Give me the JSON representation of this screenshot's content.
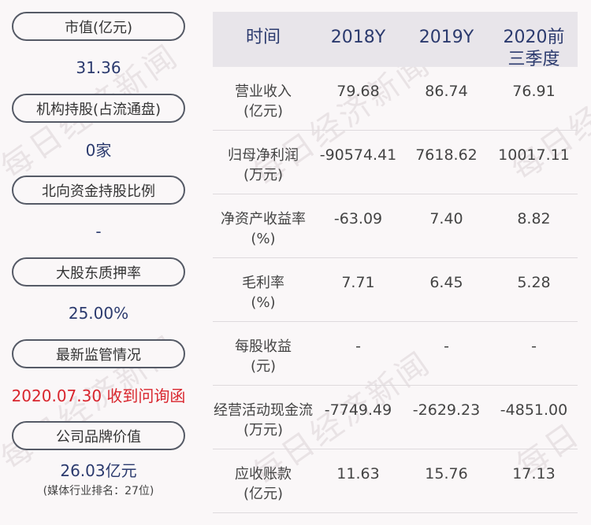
{
  "left_panel": {
    "items": [
      {
        "label": "市值(亿元)",
        "value": "31.36"
      },
      {
        "label": "机构持股(占流通盘)",
        "value": "0家"
      },
      {
        "label": "北向资金持股比例",
        "value": "-"
      },
      {
        "label": "大股东质押率",
        "value": "25.00%"
      },
      {
        "label": "最新监管情况",
        "value": "2020.07.30 收到问询函"
      },
      {
        "label": "公司品牌价值",
        "value": "26.03亿元",
        "note": "(媒体行业排名：27位)"
      }
    ]
  },
  "table": {
    "headers": [
      "时间",
      "2018Y",
      "2019Y",
      "2020前三季度"
    ],
    "rows": [
      {
        "label": "营业收入\n(亿元)",
        "values": [
          "79.68",
          "86.74",
          "76.91"
        ]
      },
      {
        "label": "归母净利润\n(万元)",
        "values": [
          "-90574.41",
          "7618.62",
          "10017.11"
        ]
      },
      {
        "label": "净资产收益率\n(%)",
        "values": [
          "-63.09",
          "7.40",
          "8.82"
        ]
      },
      {
        "label": "毛利率\n(%)",
        "values": [
          "7.71",
          "6.45",
          "5.28"
        ]
      },
      {
        "label": "每股收益\n(元)",
        "values": [
          "-",
          "-",
          "-"
        ]
      },
      {
        "label": "经营活动现金流\n(万元)",
        "values": [
          "-7749.49",
          "-2629.23",
          "-4851.00"
        ]
      },
      {
        "label": "应收账款\n(亿元)",
        "values": [
          "11.63",
          "15.76",
          "17.13"
        ]
      }
    ]
  },
  "watermark": "每日经济新闻",
  "colors": {
    "background": "#faf7f8",
    "value_blue": "#2b3a6e",
    "alert_red": "#d9262e",
    "header_bg": "#e8e5ea",
    "pill_border": "#555a66"
  }
}
